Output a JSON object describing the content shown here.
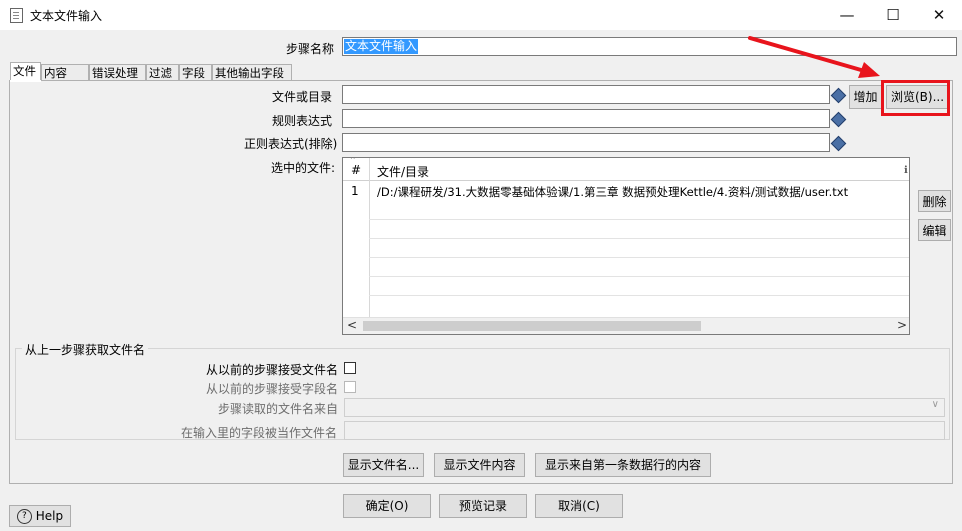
{
  "window": {
    "title": "文本文件输入",
    "minimize": "—",
    "maximize": "☐",
    "close": "✕"
  },
  "step_name": {
    "label": "步骤名称",
    "value": "文本文件输入"
  },
  "tabs": [
    "文件",
    "内容",
    "错误处理",
    "过滤",
    "字段",
    "其他输出字段"
  ],
  "file_tab": {
    "file_or_dir_label": "文件或目录",
    "regex_label": "规则表达式",
    "exclude_regex_label": "正则表达式(排除)",
    "selected_files_label": "选中的文件:",
    "add_button": "增加",
    "browse_button": "浏览(B)...",
    "delete_button": "删除",
    "edit_button": "编辑",
    "table": {
      "col_num": "#",
      "col_file": "文件/目录",
      "rows": [
        {
          "num": "1",
          "file": "/D:/课程研发/31.大数据零基础体验课/1.第三章 数据预处理Kettle/4.资料/测试数据/user.txt"
        }
      ]
    },
    "scroll_left": "<",
    "scroll_right": ">",
    "group_title": "从上一步骤获取文件名",
    "accept_filenames_label": "从以前的步骤接受文件名",
    "accept_fieldname_label": "从以前的步骤接受字段名",
    "step_source_label": "步骤读取的文件名来自",
    "field_as_filename_label": "在输入里的字段被当作文件名",
    "show_filenames_button": "显示文件名...",
    "show_content_button": "显示文件内容",
    "show_first_row_button": "显示来自第一条数据行的内容"
  },
  "footer": {
    "help_button": "Help",
    "ok_button": "确定(O)",
    "preview_button": "预览记录",
    "cancel_button": "取消(C)"
  },
  "colors": {
    "highlight": "#3399ff",
    "annotation_red": "#e8141c"
  }
}
